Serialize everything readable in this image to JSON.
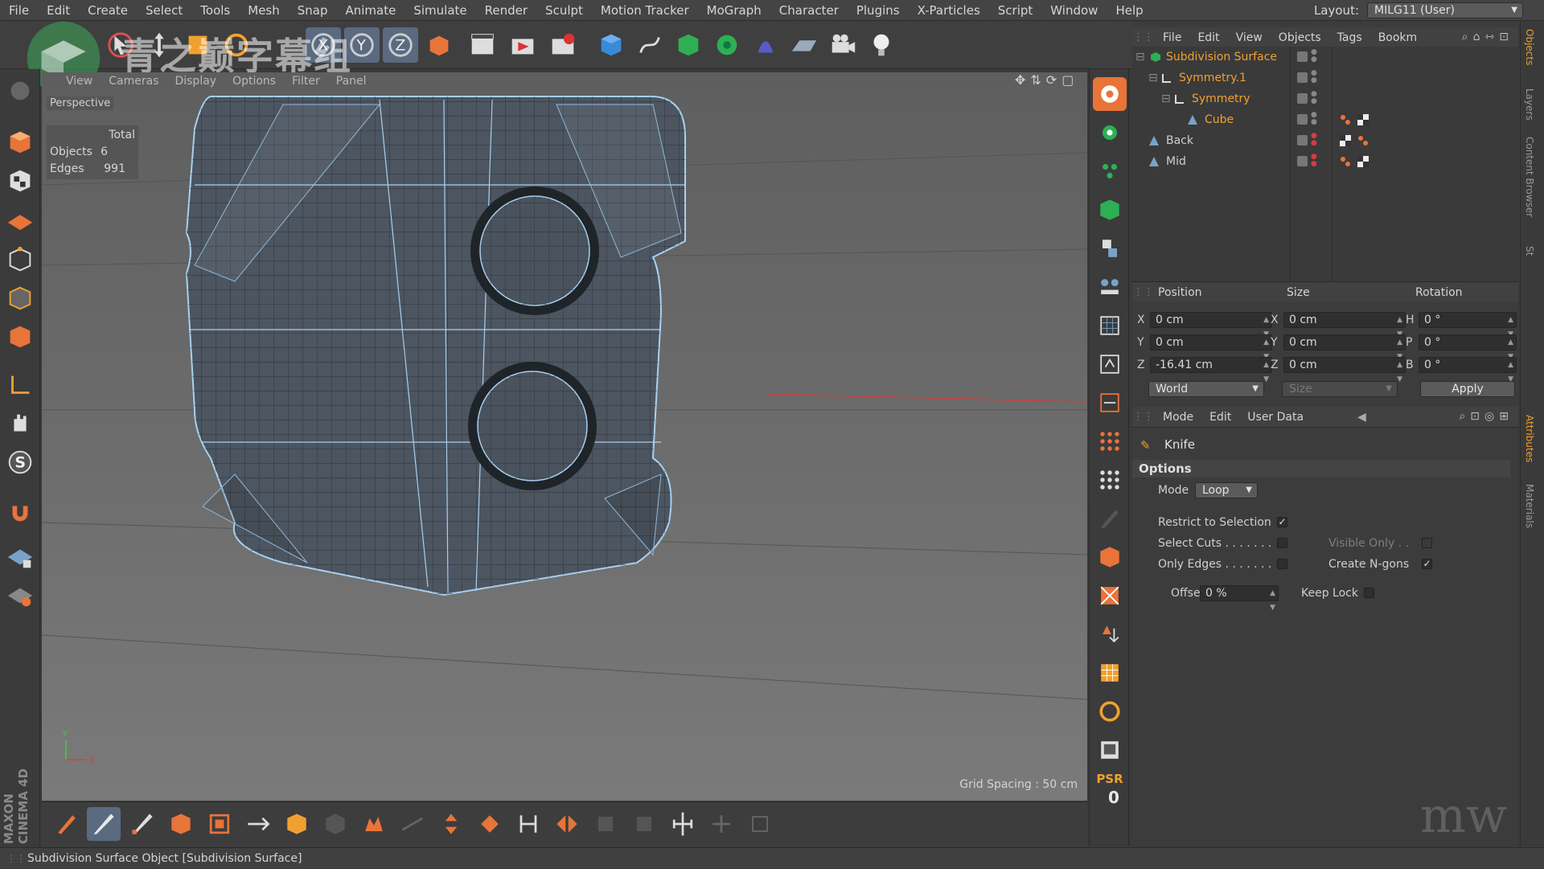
{
  "menubar": {
    "items": [
      "File",
      "Edit",
      "Create",
      "Select",
      "Tools",
      "Mesh",
      "Snap",
      "Animate",
      "Simulate",
      "Render",
      "Sculpt",
      "Motion Tracker",
      "MoGraph",
      "Character",
      "Plugins",
      "X-Particles",
      "Script",
      "Window",
      "Help"
    ],
    "layout_label": "Layout:",
    "layout_value": "MILG11 (User)"
  },
  "watermark": {
    "text": "青之巅字幕组"
  },
  "viewport": {
    "menu": [
      "View",
      "Cameras",
      "Display",
      "Options",
      "Filter",
      "Panel"
    ],
    "camera_label": "Perspective",
    "stats": {
      "header": "Total",
      "objects_label": "Objects",
      "objects_value": "6",
      "edges_label": "Edges",
      "edges_value": "991"
    },
    "grid_spacing": "Grid Spacing : 50 cm",
    "accent_wire": "#a8d0f0",
    "axis_x_color": "#d04040"
  },
  "left_brand": "MAXON CINEMA 4D",
  "objects_panel": {
    "menu": [
      "File",
      "Edit",
      "View",
      "Objects",
      "Tags",
      "Bookm"
    ],
    "items": [
      {
        "name": "Subdivision Surface",
        "color": "#f0a030"
      },
      {
        "name": "Symmetry.1",
        "color": "#f0a030"
      },
      {
        "name": "Symmetry",
        "color": "#f0a030"
      },
      {
        "name": "Cube",
        "color": "#f0a030"
      },
      {
        "name": "Back",
        "color": "#cfcfcf"
      },
      {
        "name": "Mid",
        "color": "#cfcfcf"
      }
    ]
  },
  "coord_manager": {
    "headers": {
      "position": "Position",
      "size": "Size",
      "rotation": "Rotation"
    },
    "position": {
      "x_label": "X",
      "x": "0 cm",
      "y_label": "Y",
      "y": "0 cm",
      "z_label": "Z",
      "z": "-16.41 cm"
    },
    "size": {
      "x_label": "X",
      "x": "0 cm",
      "y_label": "Y",
      "y": "0 cm",
      "z_label": "Z",
      "z": "0 cm"
    },
    "rotation": {
      "h_label": "H",
      "h": "0 °",
      "p_label": "P",
      "p": "0 °",
      "b_label": "B",
      "b": "0 °"
    },
    "world": "World",
    "size_mode": "Size",
    "apply": "Apply"
  },
  "attributes": {
    "menu": [
      "Mode",
      "Edit",
      "User Data"
    ],
    "tool_name": "Knife",
    "section": "Options",
    "mode_label": "Mode",
    "mode_value": "Loop",
    "restrict_label": "Restrict to Selection",
    "restrict_checked": "✓",
    "select_cuts_label": "Select Cuts . . . . . . .",
    "only_edges_label": "Only Edges . . . . . . .",
    "visible_only_label": "Visible Only . .",
    "create_ngons_label": "Create N-gons",
    "create_ngons_checked": "✓",
    "offset_label": "Offset",
    "offset_value": "0 %",
    "keep_lock_label": "Keep Lock"
  },
  "vtabs": [
    "Objects",
    "Layers",
    "Content Browser",
    "St",
    "Attributes",
    "Materials"
  ],
  "psr": {
    "label": "PSR",
    "value": "0"
  },
  "statusbar": {
    "text": "Subdivision Surface Object [Subdivision Surface]"
  }
}
